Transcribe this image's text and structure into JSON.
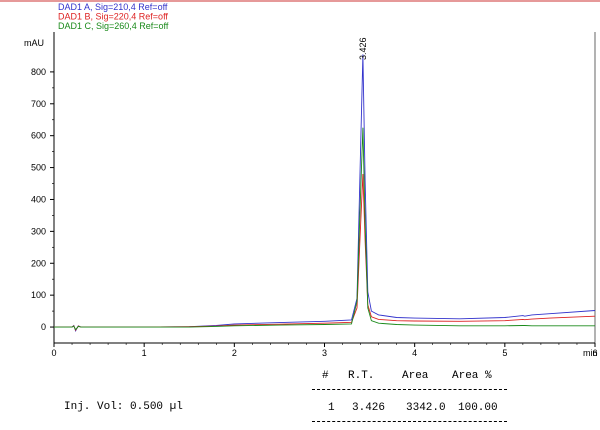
{
  "chart_data": {
    "type": "line",
    "title": "",
    "xlabel": "min",
    "ylabel": "mAU",
    "xlim": [
      0,
      6
    ],
    "ylim": [
      -50,
      900
    ],
    "xticks": [
      "0",
      "1",
      "2",
      "3",
      "4",
      "5",
      "6"
    ],
    "yticks": [
      "0",
      "100",
      "200",
      "300",
      "400",
      "500",
      "600",
      "700",
      "800"
    ],
    "peak_label": "3.426",
    "series": [
      {
        "name": "DAD1 A, Sig=210,4 Ref=off",
        "color": "#3333cc",
        "x": [
          0.0,
          0.2,
          0.22,
          0.24,
          0.27,
          0.3,
          0.5,
          1.0,
          1.5,
          1.8,
          2.0,
          2.5,
          3.0,
          3.3,
          3.36,
          3.4,
          3.426,
          3.45,
          3.48,
          3.52,
          3.6,
          3.8,
          4.0,
          4.5,
          5.0,
          5.2,
          5.22,
          5.3,
          5.5,
          6.0
        ],
        "y": [
          0,
          0,
          5,
          -12,
          4,
          0,
          0,
          0,
          1,
          5,
          10,
          14,
          18,
          22,
          90,
          560,
          855,
          460,
          110,
          50,
          38,
          30,
          28,
          26,
          30,
          36,
          34,
          38,
          42,
          52
        ]
      },
      {
        "name": "DAD1 B, Sig=220,4 Ref=off",
        "color": "#dd2222",
        "x": [
          0.0,
          0.2,
          0.22,
          0.24,
          0.27,
          0.3,
          0.5,
          1.0,
          1.5,
          1.8,
          2.0,
          2.5,
          3.0,
          3.3,
          3.36,
          3.4,
          3.426,
          3.45,
          3.48,
          3.52,
          3.6,
          3.8,
          4.0,
          4.5,
          5.0,
          5.2,
          5.22,
          5.3,
          5.5,
          6.0
        ],
        "y": [
          0,
          0,
          4,
          -10,
          3,
          0,
          0,
          0,
          1,
          3,
          6,
          9,
          12,
          15,
          60,
          320,
          480,
          270,
          70,
          32,
          24,
          20,
          19,
          18,
          20,
          24,
          23,
          25,
          28,
          34
        ]
      },
      {
        "name": "DAD1 C, Sig=260,4 Ref=off",
        "color": "#1a8a1a",
        "x": [
          0.0,
          0.2,
          0.22,
          0.24,
          0.27,
          0.3,
          0.5,
          1.0,
          1.5,
          1.8,
          2.0,
          2.5,
          3.0,
          3.3,
          3.36,
          3.4,
          3.426,
          3.45,
          3.48,
          3.52,
          3.6,
          3.8,
          4.0,
          4.5,
          5.0,
          5.2,
          5.22,
          5.3,
          5.5,
          6.0
        ],
        "y": [
          0,
          0,
          3,
          -8,
          2,
          0,
          0,
          0,
          0,
          2,
          4,
          6,
          8,
          10,
          80,
          420,
          625,
          330,
          60,
          20,
          12,
          8,
          6,
          4,
          4,
          5,
          5,
          4,
          4,
          4
        ]
      }
    ],
    "grid": false,
    "legend_position": "top-left"
  },
  "injection": {
    "label": "Inj. Vol: 0.500 µl"
  },
  "peak_table": {
    "headers": [
      "#",
      "R.T.",
      "Area",
      "Area %"
    ],
    "rows": [
      [
        "1",
        "3.426",
        "3342.0",
        "100.00"
      ]
    ]
  }
}
